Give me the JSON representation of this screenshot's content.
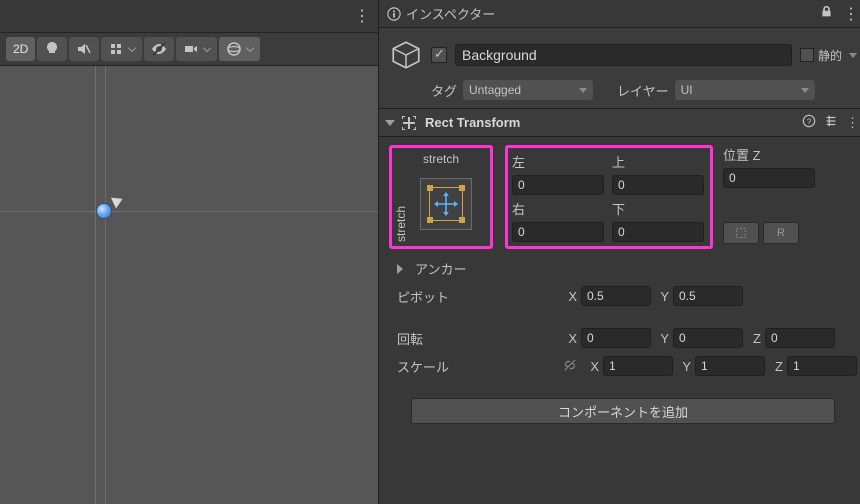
{
  "inspector": {
    "tab_title": "インスペクター",
    "static_label": "静的"
  },
  "game_object": {
    "active": true,
    "name": "Background",
    "tag_label": "タグ",
    "tag_value": "Untagged",
    "layer_label": "レイヤー",
    "layer_value": "UI"
  },
  "rect_transform": {
    "title": "Rect Transform",
    "anchor_preset_h": "stretch",
    "anchor_preset_v": "stretch",
    "labels": {
      "left": "左",
      "top": "上",
      "right": "右",
      "bottom": "下",
      "posz": "位置 Z"
    },
    "left": "0",
    "top": "0",
    "right": "0",
    "bottom": "0",
    "posz": "0",
    "anchors_label": "アンカー",
    "pivot_label": "ピボット",
    "pivot_x": "0.5",
    "pivot_y": "0.5",
    "rotation_label": "回転",
    "rot_x": "0",
    "rot_y": "0",
    "rot_z": "0",
    "scale_label": "スケール",
    "scale_x": "1",
    "scale_y": "1",
    "scale_z": "1"
  },
  "scene_toolbar": {
    "mode_2d": "2D"
  },
  "buttons": {
    "add_component": "コンポーネントを追加",
    "blueprint": "R"
  },
  "axes": {
    "x": "X",
    "y": "Y",
    "z": "Z"
  }
}
